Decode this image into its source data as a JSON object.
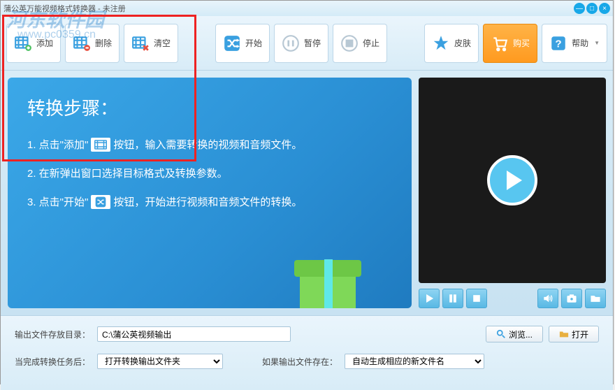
{
  "window": {
    "title": "蒲公英万能视频格式转换器 - 未注册"
  },
  "toolbar": {
    "add": "添加",
    "delete": "删除",
    "clear": "清空",
    "start": "开始",
    "pause": "暂停",
    "stop": "停止",
    "skin": "皮肤",
    "buy": "购买",
    "help": "帮助"
  },
  "guide": {
    "title": "转换步骤：",
    "step1a": "1. 点击\"添加\"",
    "step1b": "按钮，输入需要转换的视频和音频文件。",
    "step2": "2. 在新弹出窗口选择目标格式及转换参数。",
    "step3a": "3. 点击\"开始\"",
    "step3b": "按钮，开始进行视频和音频文件的转换。"
  },
  "output": {
    "dir_label": "输出文件存放目录：",
    "dir_value": "C:\\蒲公英视频输出",
    "browse": "浏览...",
    "open": "打开",
    "after_label": "当完成转换任务后：",
    "after_value": "打开转换输出文件夹",
    "exist_label": "如果输出文件存在：",
    "exist_value": "自动生成相应的新文件名"
  },
  "watermark": {
    "main": "河东软件园",
    "url": "www.pc0359.cn"
  }
}
